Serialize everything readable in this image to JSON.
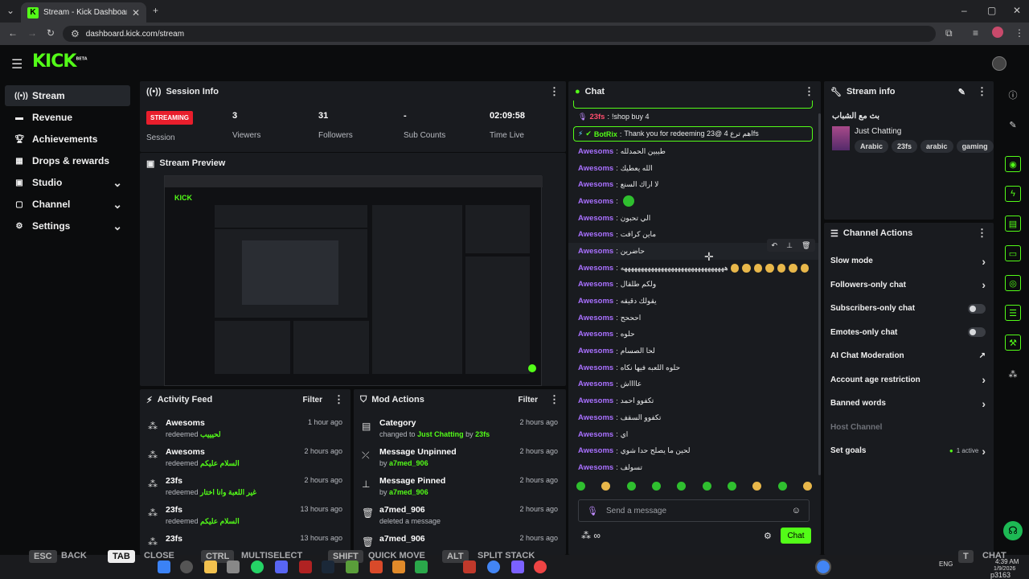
{
  "browser": {
    "tab_title": "Stream - Kick Dashboard",
    "url": "dashboard.kick.com/stream"
  },
  "logo": {
    "text": "KICK",
    "beta": "BETA"
  },
  "sidebar": {
    "items": [
      {
        "label": "Stream",
        "icon": "broadcast-icon"
      },
      {
        "label": "Revenue",
        "icon": "wallet-icon"
      },
      {
        "label": "Achievements",
        "icon": "trophy-icon"
      },
      {
        "label": "Drops & rewards",
        "icon": "gift-icon"
      },
      {
        "label": "Studio",
        "icon": "studio-icon"
      },
      {
        "label": "Channel",
        "icon": "channel-icon"
      },
      {
        "label": "Settings",
        "icon": "gear-icon"
      }
    ]
  },
  "session": {
    "title": "Session Info",
    "status": "STREAMING",
    "status_label": "Session",
    "stats": [
      {
        "value": "3",
        "label": "Viewers"
      },
      {
        "value": "31",
        "label": "Followers"
      },
      {
        "value": "-",
        "label": "Sub Counts"
      },
      {
        "value": "02:09:58",
        "label": "Time Live"
      }
    ]
  },
  "preview": {
    "title": "Stream Preview"
  },
  "activity": {
    "title": "Activity Feed",
    "filter": "Filter",
    "items": [
      {
        "name": "Awesoms",
        "action": "redeemed",
        "reward": "لحيييب",
        "time": "1 hour ago"
      },
      {
        "name": "Awesoms",
        "action": "redeemed",
        "reward": "السلام عليكم",
        "time": "2 hours ago"
      },
      {
        "name": "23fs",
        "action": "redeemed",
        "reward": "غير اللعبة وانا اختار",
        "time": "2 hours ago"
      },
      {
        "name": "23fs",
        "action": "redeemed",
        "reward": "السلام عليكم",
        "time": "13 hours ago"
      },
      {
        "name": "23fs",
        "action": "redeemed",
        "reward": "",
        "time": "13 hours ago"
      }
    ]
  },
  "mod": {
    "title": "Mod Actions",
    "filter": "Filter",
    "items": [
      {
        "name": "Category",
        "pre": "changed to",
        "mid": "Just Chatting",
        "by": "by",
        "user": "23fs",
        "time": "2 hours ago",
        "icon": "category-icon"
      },
      {
        "name": "Message Unpinned",
        "pre": "",
        "mid": "",
        "by": "by",
        "user": "a7med_906",
        "time": "2 hours ago",
        "icon": "unpin-icon"
      },
      {
        "name": "Message Pinned",
        "pre": "",
        "mid": "",
        "by": "by",
        "user": "a7med_906",
        "time": "2 hours ago",
        "icon": "pin-icon"
      },
      {
        "name": "a7med_906",
        "pre": "deleted a message",
        "mid": "",
        "by": "",
        "user": "",
        "time": "2 hours ago",
        "icon": "trash-icon"
      },
      {
        "name": "a7med_906",
        "pre": "",
        "mid": "",
        "by": "",
        "user": "",
        "time": "2 hours ago",
        "icon": "trash-icon"
      }
    ]
  },
  "chat": {
    "title": "Chat",
    "top_msg": {
      "user": "23fs",
      "text": "!shop buy 4"
    },
    "bot": {
      "user": "BotRix",
      "text": "Thank you for redeeming 23@ اهم ترع 4fs"
    },
    "messages": [
      {
        "user": "Awesoms",
        "text": "طيبين الحمدلله"
      },
      {
        "user": "Awesoms",
        "text": "الله يعطيك"
      },
      {
        "user": "Awesoms",
        "text": "لا اراك السنع"
      },
      {
        "user": "Awesoms",
        "text": ""
      },
      {
        "user": "Awesoms",
        "text": "الي تحبون"
      },
      {
        "user": "Awesoms",
        "text": "ماين كرافت"
      },
      {
        "user": "Awesoms",
        "text": "حاضرين"
      },
      {
        "user": "Awesoms",
        "text": "هههههههههههههههههههههههههههههههه"
      },
      {
        "user": "Awesoms",
        "text": "ولكم طلقال"
      },
      {
        "user": "Awesoms",
        "text": "يقولك دقيقه"
      },
      {
        "user": "Awesoms",
        "text": "احححح"
      },
      {
        "user": "Awesoms",
        "text": "حلوه"
      },
      {
        "user": "Awesoms",
        "text": "لحا الصسام"
      },
      {
        "user": "Awesoms",
        "text": "حلوه اللعبه فيها نكاه"
      },
      {
        "user": "Awesoms",
        "text": "عااااش"
      },
      {
        "user": "Awesoms",
        "text": "تكفوو احمد"
      },
      {
        "user": "Awesoms",
        "text": "تكفوو السقف"
      },
      {
        "user": "Awesoms",
        "text": "اي"
      },
      {
        "user": "Awesoms",
        "text": "لحين ما يصلح حدا شوي"
      },
      {
        "user": "Awesoms",
        "text": "تسولف"
      }
    ],
    "input_placeholder": "Send a message",
    "send": "Chat"
  },
  "stream_info": {
    "title": "Stream info",
    "stream_title": "بث مع الشباب",
    "category": "Just Chatting",
    "tags": [
      "Arabic",
      "23fs",
      "arabic",
      "gaming"
    ]
  },
  "channel_actions": {
    "title": "Channel Actions",
    "items": [
      {
        "label": "Slow mode",
        "control": "chevron"
      },
      {
        "label": "Followers-only chat",
        "control": "chevron"
      },
      {
        "label": "Subscribers-only chat",
        "control": "toggle"
      },
      {
        "label": "Emotes-only chat",
        "control": "toggle"
      },
      {
        "label": "AI Chat Moderation",
        "control": "external"
      },
      {
        "label": "Account age restriction",
        "control": "chevron"
      },
      {
        "label": "Banned words",
        "control": "chevron"
      },
      {
        "label": "Host Channel",
        "control": "none"
      },
      {
        "label": "Set goals",
        "control": "chevron",
        "extra": "1 active"
      }
    ]
  },
  "overlay_keys": [
    {
      "key": "ESC",
      "label": "BACK"
    },
    {
      "key": "TAB",
      "label": "CLOSE"
    },
    {
      "key": "CTRL",
      "label": "MULTISELECT"
    },
    {
      "key": "SHIFT",
      "label": "QUICK MOVE"
    },
    {
      "key": "ALT",
      "label": "SPLIT STACK"
    },
    {
      "key": "T",
      "label": "CHAT"
    }
  ],
  "taskbar": {
    "lang": "ENG",
    "time": "4:39 AM",
    "date": "1/9/2026",
    "version": "p3163"
  },
  "colors": {
    "accent": "#53fc18",
    "username": "#a970ff",
    "live": "#e91e2c"
  }
}
